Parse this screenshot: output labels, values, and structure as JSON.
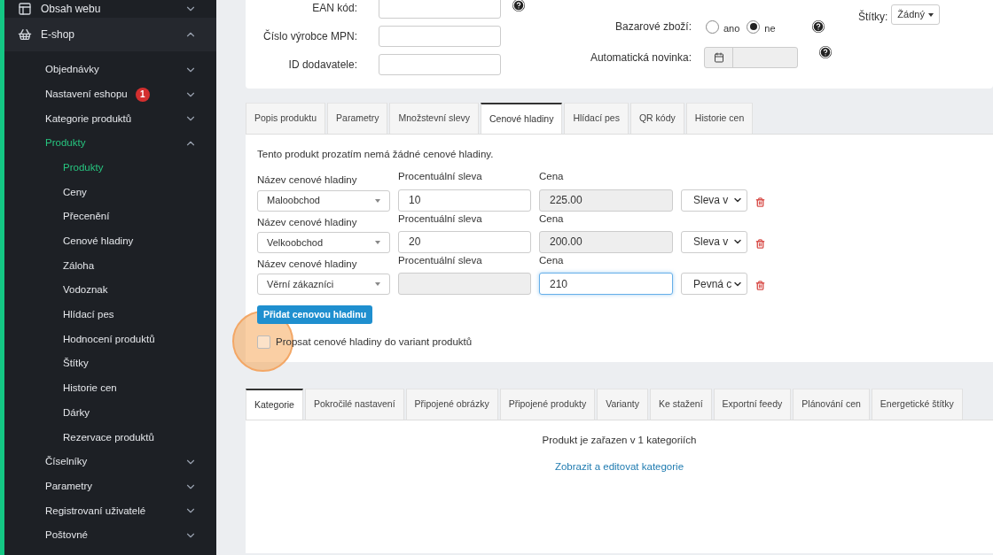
{
  "sidebar": {
    "items": [
      {
        "label": "Obsah webu",
        "expanded": false
      },
      {
        "label": "E-shop",
        "expanded": true,
        "children": [
          {
            "label": "Objednávky",
            "expanded": false,
            "selected": false
          },
          {
            "label": "Nastavení eshopu",
            "badge": "1",
            "expanded": false,
            "selected": false
          },
          {
            "label": "Kategorie produktů",
            "expanded": false,
            "selected": false
          },
          {
            "label": "Produkty",
            "expanded": true,
            "selected": true,
            "children": [
              {
                "label": "Produkty",
                "selected": true
              },
              {
                "label": "Ceny",
                "selected": false
              },
              {
                "label": "Přecenění",
                "selected": false
              },
              {
                "label": "Cenové hladiny",
                "selected": false
              },
              {
                "label": "Záloha",
                "selected": false
              },
              {
                "label": "Vodoznak",
                "selected": false
              },
              {
                "label": "Hlídací pes",
                "selected": false
              },
              {
                "label": "Hodnocení produktů",
                "selected": false
              },
              {
                "label": "Štítky",
                "selected": false
              },
              {
                "label": "Historie cen",
                "selected": false
              },
              {
                "label": "Dárky",
                "selected": false
              },
              {
                "label": "Rezervace produktů",
                "selected": false
              }
            ]
          },
          {
            "label": "Číselníky",
            "expanded": false,
            "selected": false
          },
          {
            "label": "Parametry",
            "expanded": false,
            "selected": false
          },
          {
            "label": "Registrovaní uživatelé",
            "expanded": false,
            "selected": false
          },
          {
            "label": "Poštovné",
            "expanded": false,
            "selected": false
          }
        ]
      }
    ]
  },
  "product_form": {
    "left_fields": [
      {
        "label": "EAN kód:",
        "help": true
      },
      {
        "label": "Číslo výrobce MPN:",
        "help": false
      },
      {
        "label": "ID dodavatele:",
        "help": false
      }
    ],
    "used_goods": {
      "label": "Bazarové zboží:",
      "options": [
        {
          "label": "ano",
          "selected": false
        },
        {
          "label": "ne",
          "selected": true
        }
      ]
    },
    "auto_new": {
      "label": "Automatická novinka:"
    },
    "tags": {
      "label": "Štítky:",
      "value": "Žádný"
    }
  },
  "price_tabs": [
    {
      "label": "Popis produktu",
      "selected": false
    },
    {
      "label": "Parametry",
      "selected": false
    },
    {
      "label": "Množstevní slevy",
      "selected": false
    },
    {
      "label": "Cenové hladiny",
      "selected": true
    },
    {
      "label": "Hlídací pes",
      "selected": false
    },
    {
      "label": "QR kódy",
      "selected": false
    },
    {
      "label": "Historie cen",
      "selected": false
    }
  ],
  "price_levels": {
    "message": "Tento produkt prozatím nemá žádné cenové hladiny.",
    "rows": [
      {
        "name_label": "Název cenové hladiny",
        "name": "Maloobchod",
        "discount_label": "Procentuální sleva",
        "discount": "10",
        "discount_disabled": false,
        "price_label": "Cena",
        "price": "225.00",
        "price_disabled": true,
        "price_focused": false,
        "type": "Sleva v"
      },
      {
        "name_label": "Název cenové hladiny",
        "name": "Velkoobchod",
        "discount_label": "Procentuální sleva",
        "discount": "20",
        "discount_disabled": false,
        "price_label": "Cena",
        "price": "200.00",
        "price_disabled": true,
        "price_focused": false,
        "type": "Sleva v"
      },
      {
        "name_label": "Název cenové hladiny",
        "name": "Věrní zákazníci",
        "discount_label": "Procentuální sleva",
        "discount_disabled": true,
        "price_label": "Cena",
        "price": "210",
        "price_disabled": false,
        "price_focused": true,
        "type": "Pevná c"
      }
    ],
    "add_button": "Přidat cenovou hladinu",
    "propagate": {
      "label": "Propsat cenové hladiny do variant produktů",
      "checked": false,
      "highlighted": true
    }
  },
  "bottom_tabs": [
    {
      "label": "Kategorie",
      "selected": true
    },
    {
      "label": "Pokročilé nastavení",
      "selected": false
    },
    {
      "label": "Připojené obrázky",
      "selected": false
    },
    {
      "label": "Připojené produkty",
      "selected": false
    },
    {
      "label": "Varianty",
      "selected": false
    },
    {
      "label": "Ke stažení",
      "selected": false
    },
    {
      "label": "Exportní feedy",
      "selected": false
    },
    {
      "label": "Plánování cen",
      "selected": false
    },
    {
      "label": "Energetické štítky",
      "selected": false
    }
  ],
  "categories": {
    "text": "Produkt je zařazen v 1 kategoriích",
    "link": "Zobrazit a editovat kategorie"
  }
}
